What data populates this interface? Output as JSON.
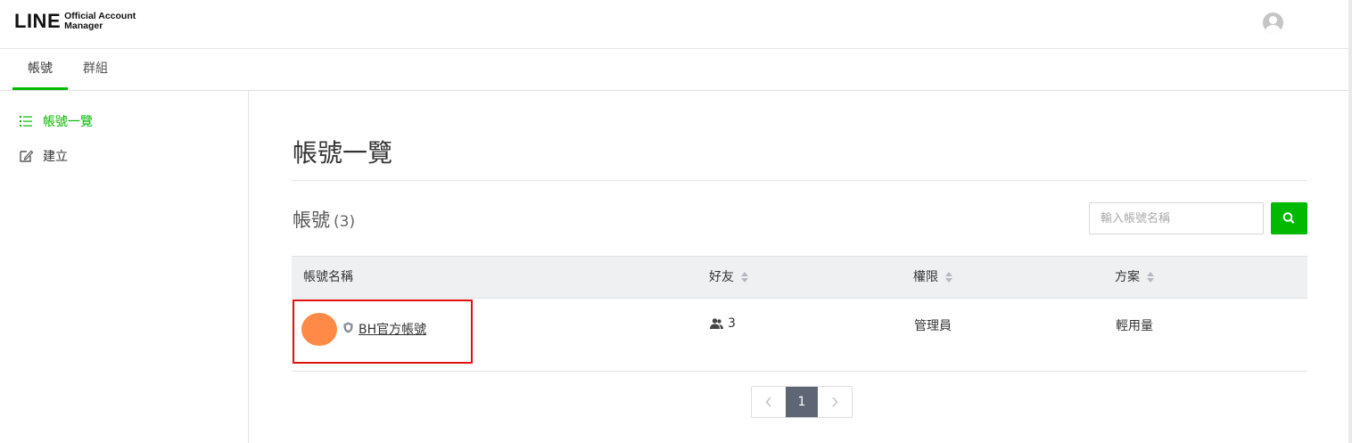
{
  "header": {
    "logo_main": "LINE",
    "logo_sub_line1": "Official Account",
    "logo_sub_line2": "Manager",
    "avatar_icon": "user-avatar-icon"
  },
  "tabs": [
    {
      "label": "帳號",
      "active": true
    },
    {
      "label": "群組",
      "active": false
    }
  ],
  "sidebar": {
    "items": [
      {
        "label": "帳號一覽",
        "icon": "list-icon",
        "active": true
      },
      {
        "label": "建立",
        "icon": "edit-icon",
        "active": false
      }
    ]
  },
  "main": {
    "page_title": "帳號一覽",
    "section_title": "帳號",
    "section_count": "(3)",
    "search": {
      "placeholder": "輸入帳號名稱",
      "value": ""
    },
    "table": {
      "columns": [
        "帳號名稱",
        "好友",
        "權限",
        "方案"
      ],
      "rows": [
        {
          "name": "BH官方帳號",
          "friends": "3",
          "role": "管理員",
          "plan": "輕用量"
        }
      ]
    },
    "pagination": {
      "current": "1"
    }
  },
  "colors": {
    "accent": "#00b900",
    "avatar": "#ff8a47",
    "highlight": "#e01010",
    "pager_current": "#5e6675"
  }
}
